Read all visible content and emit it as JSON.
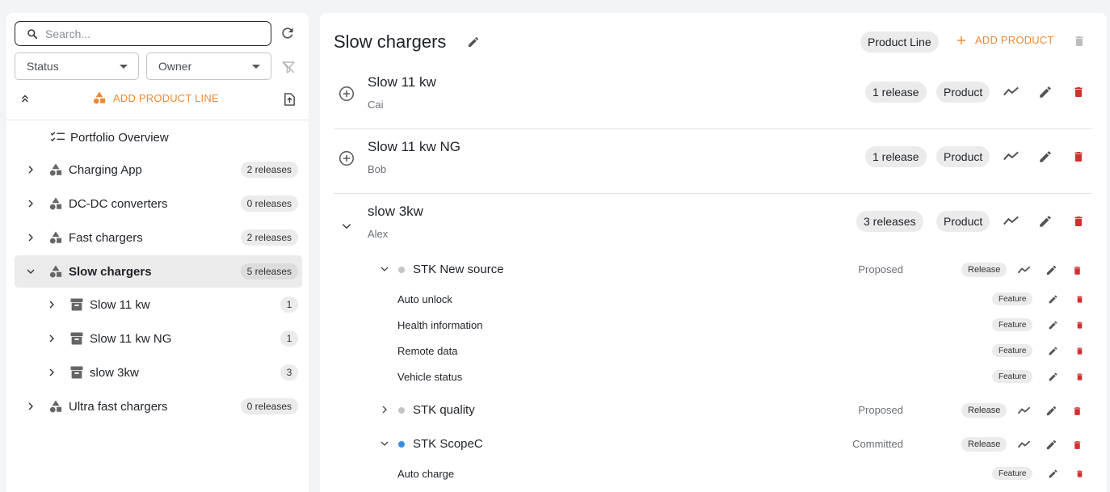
{
  "sidebar": {
    "search_placeholder": "Search...",
    "filters": {
      "status": "Status",
      "owner": "Owner"
    },
    "add_product_line_label": "ADD PRODUCT LINE",
    "portfolio_overview": "Portfolio Overview",
    "tree": [
      {
        "label": "Charging App",
        "badge": "2 releases"
      },
      {
        "label": "DC-DC converters",
        "badge": "0 releases"
      },
      {
        "label": "Fast chargers",
        "badge": "2 releases"
      },
      {
        "label": "Slow chargers",
        "badge": "5 releases",
        "active": true,
        "children": [
          {
            "label": "Slow 11 kw",
            "badge": "1"
          },
          {
            "label": "Slow 11 kw NG",
            "badge": "1"
          },
          {
            "label": "slow 3kw",
            "badge": "3"
          }
        ]
      },
      {
        "label": "Ultra fast chargers",
        "badge": "0 releases"
      }
    ]
  },
  "main": {
    "title": "Slow chargers",
    "type_chip": "Product Line",
    "add_product_label": "ADD PRODUCT",
    "products": [
      {
        "name": "Slow 11 kw",
        "owner": "Cai",
        "releases_chip": "1 release",
        "type_chip": "Product"
      },
      {
        "name": "Slow 11 kw NG",
        "owner": "Bob",
        "releases_chip": "1 release",
        "type_chip": "Product"
      },
      {
        "name": "slow 3kw",
        "owner": "Alex",
        "releases_chip": "3 releases",
        "type_chip": "Product"
      }
    ],
    "releases": [
      {
        "name": "STK New source",
        "status": "Proposed",
        "chip": "Release",
        "dot_color": "#c4c4c4"
      },
      {
        "name": "STK quality",
        "status": "Proposed",
        "chip": "Release",
        "dot_color": "#c4c4c4"
      },
      {
        "name": "STK ScopeC",
        "status": "Committed",
        "chip": "Release",
        "dot_color": "#3b8ede"
      }
    ],
    "features": [
      {
        "name": "Auto unlock",
        "chip": "Feature"
      },
      {
        "name": "Health information",
        "chip": "Feature"
      },
      {
        "name": "Remote data",
        "chip": "Feature"
      },
      {
        "name": "Vehicle status",
        "chip": "Feature"
      },
      {
        "name": "Auto charge",
        "chip": "Feature"
      }
    ]
  },
  "colors": {
    "accent": "#ed8936",
    "danger": "#d32f2f",
    "committed": "#3b8ede",
    "proposed": "#c4c4c4"
  },
  "icons": [
    "search-icon",
    "refresh-icon",
    "filter-off-icon",
    "collapse-all-icon",
    "shapes-icon",
    "export-icon",
    "checklist-icon",
    "chevron-right-icon",
    "chevron-down-icon",
    "archive-box-icon",
    "pencil-icon",
    "plus-icon",
    "trash-icon",
    "add-circle-icon",
    "trend-icon"
  ]
}
